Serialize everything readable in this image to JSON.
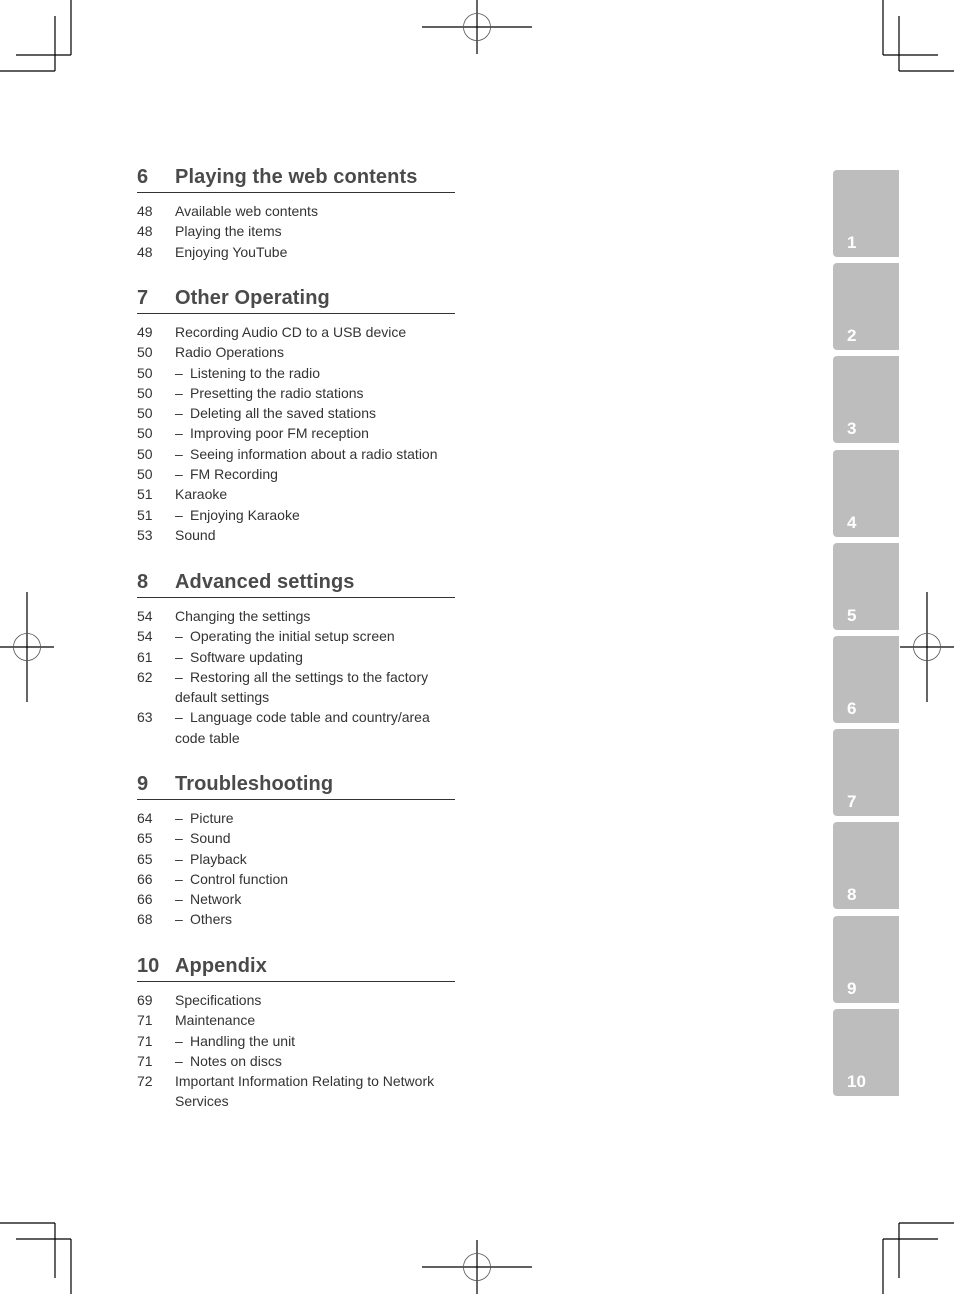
{
  "sections": [
    {
      "number": "6",
      "title": "Playing the web contents",
      "entries": [
        {
          "page": "48",
          "dash": false,
          "text": "Available web contents"
        },
        {
          "page": "48",
          "dash": false,
          "text": "Playing the items"
        },
        {
          "page": "48",
          "dash": false,
          "text": "Enjoying YouTube"
        }
      ]
    },
    {
      "number": "7",
      "title": "Other Operating",
      "entries": [
        {
          "page": "49",
          "dash": false,
          "text": "Recording Audio CD to a USB device"
        },
        {
          "page": "50",
          "dash": false,
          "text": "Radio Operations"
        },
        {
          "page": "50",
          "dash": true,
          "text": "Listening to the radio"
        },
        {
          "page": "50",
          "dash": true,
          "text": "Presetting the radio stations"
        },
        {
          "page": "50",
          "dash": true,
          "text": "Deleting all the saved stations"
        },
        {
          "page": "50",
          "dash": true,
          "text": "Improving poor FM reception"
        },
        {
          "page": "50",
          "dash": true,
          "text": "Seeing information about a radio station"
        },
        {
          "page": "50",
          "dash": true,
          "text": "FM Recording"
        },
        {
          "page": "51",
          "dash": false,
          "text": "Karaoke"
        },
        {
          "page": "51",
          "dash": true,
          "text": "Enjoying Karaoke"
        },
        {
          "page": "53",
          "dash": false,
          "text": "Sound"
        }
      ]
    },
    {
      "number": "8",
      "title": "Advanced settings",
      "entries": [
        {
          "page": "54",
          "dash": false,
          "text": "Changing the settings"
        },
        {
          "page": "54",
          "dash": true,
          "text": "Operating the initial setup screen"
        },
        {
          "page": "61",
          "dash": true,
          "text": "Software updating"
        },
        {
          "page": "62",
          "dash": true,
          "text": "Restoring all the settings to the factory default settings"
        },
        {
          "page": "63",
          "dash": true,
          "text": "Language code table and country/area code table"
        }
      ]
    },
    {
      "number": "9",
      "title": "Troubleshooting",
      "entries": [
        {
          "page": "64",
          "dash": true,
          "text": "Picture"
        },
        {
          "page": "65",
          "dash": true,
          "text": "Sound"
        },
        {
          "page": "65",
          "dash": true,
          "text": "Playback"
        },
        {
          "page": "66",
          "dash": true,
          "text": "Control function"
        },
        {
          "page": "66",
          "dash": true,
          "text": "Network"
        },
        {
          "page": "68",
          "dash": true,
          "text": "Others"
        }
      ]
    },
    {
      "number": "10",
      "title": "Appendix",
      "entries": [
        {
          "page": "69",
          "dash": false,
          "text": "Specifications"
        },
        {
          "page": "71",
          "dash": false,
          "text": "Maintenance"
        },
        {
          "page": "71",
          "dash": true,
          "text": "Handling the unit"
        },
        {
          "page": "71",
          "dash": true,
          "text": "Notes on discs"
        },
        {
          "page": "72",
          "dash": false,
          "text": "Important Information Relating to Network Services"
        }
      ]
    }
  ],
  "dash_glyph": "–",
  "chapter_tabs": [
    "1",
    "2",
    "3",
    "4",
    "5",
    "6",
    "7",
    "8",
    "9",
    "10"
  ],
  "colors": {
    "tab_fill": "#bdbdbd",
    "tab_text": "#ffffff",
    "heading_text": "#4a4a4a",
    "body_text": "#333333"
  }
}
